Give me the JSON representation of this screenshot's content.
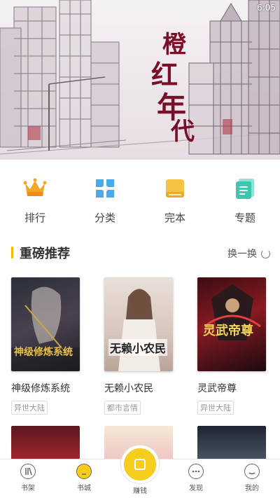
{
  "status_bar": {
    "time": "6:05"
  },
  "banner": {
    "title_chars": [
      "橙",
      "红",
      "年",
      "代"
    ]
  },
  "categories": [
    {
      "label": "排行",
      "icon": "crown-icon",
      "color": "#f5a623"
    },
    {
      "label": "分类",
      "icon": "grid-petals-icon",
      "color": "#4aa9e9"
    },
    {
      "label": "完本",
      "icon": "book-icon",
      "color": "#f6c243"
    },
    {
      "label": "专题",
      "icon": "list-doc-icon",
      "color": "#3ec7b0"
    }
  ],
  "section": {
    "title": "重磅推荐",
    "refresh_label": "换一换"
  },
  "books": [
    {
      "title": "神级修炼系统",
      "tag": "异世大陆",
      "cover_text": "神级修炼系统"
    },
    {
      "title": "无赖小农民",
      "tag": "都市言情",
      "cover_text": "无赖小农民"
    },
    {
      "title": "灵武帝尊",
      "tag": "异世大陆",
      "cover_text": "灵武帝尊"
    }
  ],
  "bottom_nav": [
    {
      "label": "书架",
      "icon": "bookshelf-icon"
    },
    {
      "label": "书城",
      "icon": "bulb-icon"
    },
    {
      "label": "赚钱",
      "icon": "coin-icon"
    },
    {
      "label": "发现",
      "icon": "chat-icon"
    },
    {
      "label": "我的",
      "icon": "face-icon"
    }
  ],
  "colors": {
    "accent": "#f5b800",
    "center_button": "#f6cc1f",
    "banner_title": "#7a0f2a"
  }
}
